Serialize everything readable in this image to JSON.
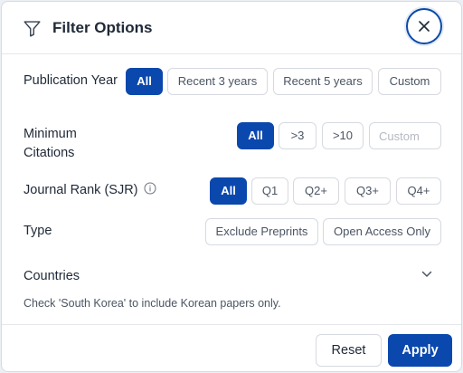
{
  "header": {
    "title": "Filter Options"
  },
  "publication_year": {
    "label": "Publication Year",
    "options": [
      "All",
      "Recent 3 years",
      "Recent 5 years",
      "Custom"
    ],
    "selected": "All"
  },
  "minimum_citations": {
    "label": "Minimum Citations",
    "options": [
      "All",
      ">3",
      ">10"
    ],
    "selected": "All",
    "custom_placeholder": "Custom"
  },
  "journal_rank": {
    "label": "Journal Rank (SJR)",
    "options": [
      "All",
      "Q1",
      "Q2+",
      "Q3+",
      "Q4+"
    ],
    "selected": "All"
  },
  "type": {
    "label": "Type",
    "options": [
      "Exclude Preprints",
      "Open Access Only"
    ]
  },
  "countries": {
    "label": "Countries",
    "hint": "Check 'South Korea' to include Korean papers only."
  },
  "footer": {
    "reset_label": "Reset",
    "apply_label": "Apply"
  },
  "colors": {
    "accent": "#0b48ad",
    "border": "#d6dae0",
    "text": "#1f2937",
    "muted": "#4b5563"
  }
}
